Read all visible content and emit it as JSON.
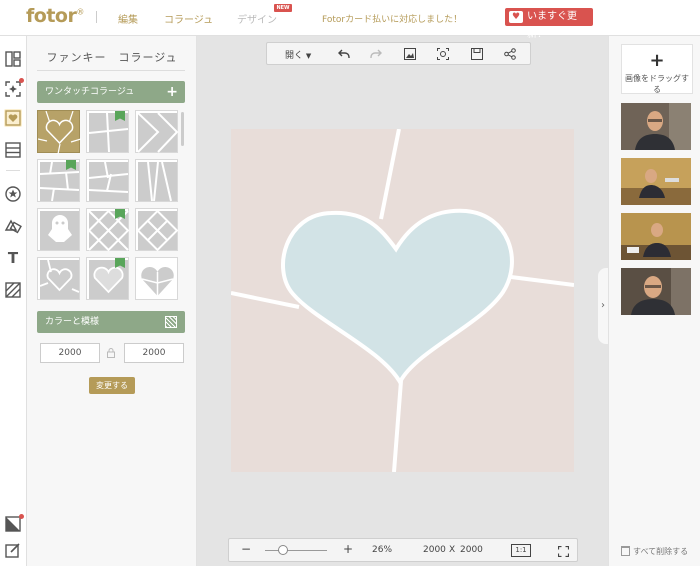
{
  "header": {
    "logo": "fotor",
    "logo_mark": "®",
    "nav": [
      {
        "label": "編集"
      },
      {
        "label": "コラージュ"
      },
      {
        "label": "デザイン"
      }
    ],
    "new_badge": "NEW",
    "notice": "Fotorカード払いに対応しました！",
    "upgrade_label": "いますぐ更新！"
  },
  "rail": {
    "icons": [
      "layout-icon",
      "sparkle-icon",
      "heart-icon",
      "rows-icon",
      "star-icon",
      "shapes-icon",
      "text-icon",
      "hatch-icon",
      "corner-icon",
      "edit-icon"
    ]
  },
  "panel": {
    "title": "ファンキー　コラージュ",
    "one_touch_label": "ワンタッチコラージュ",
    "color_pattern_label": "カラーと模様",
    "width_value": "2000",
    "height_value": "2000",
    "apply_label": "変更する"
  },
  "toolbar": {
    "open_label": "開く"
  },
  "bottom_bar": {
    "zoom_level": "26%",
    "size_w": "2000",
    "size_x": "X",
    "size_h": "2000",
    "ratio_label": "1:1",
    "minus": "−",
    "plus": "+"
  },
  "right_panel": {
    "drop_plus": "+",
    "drop_label": "画像をドラッグする",
    "delete_all_label": "すべて削除する"
  },
  "colors": {
    "brand": "#b59b58",
    "accent_red": "#d9534f",
    "green": "#8ea888",
    "canvas_bg": "#e8ddd9",
    "heart": "#d2e3e6"
  }
}
